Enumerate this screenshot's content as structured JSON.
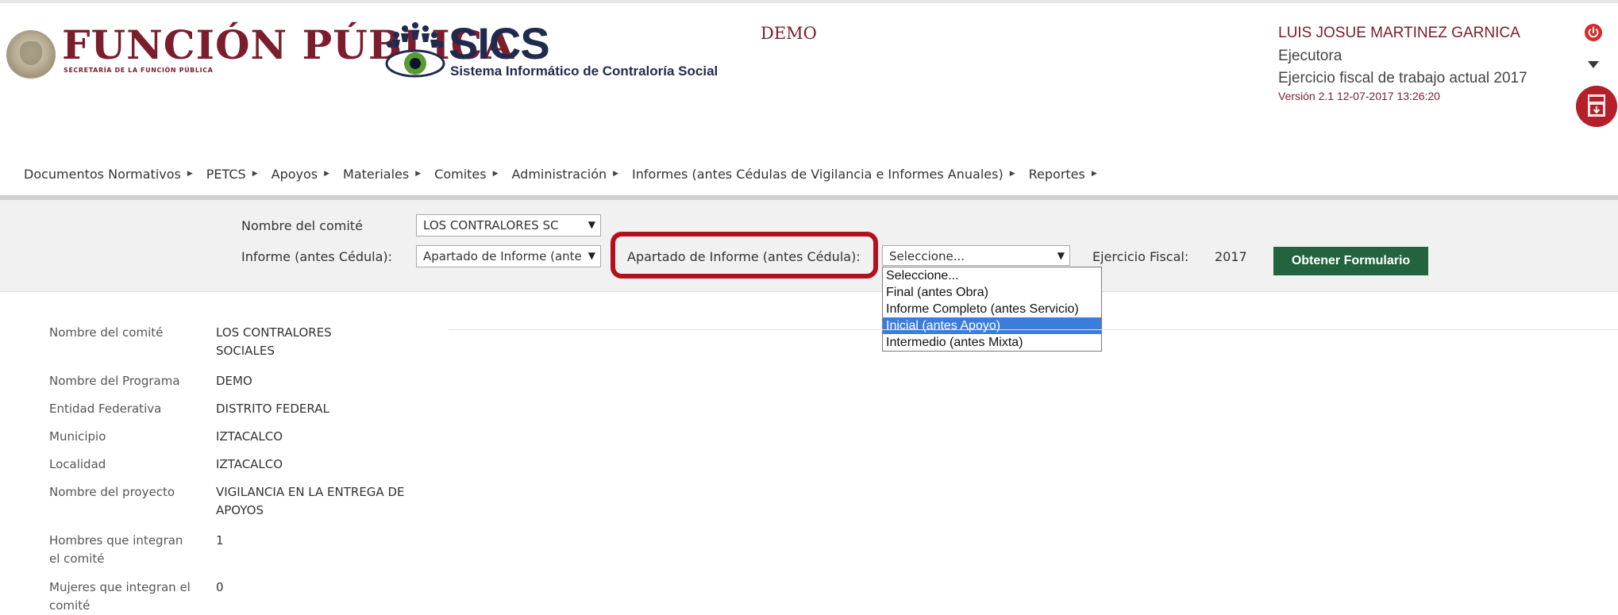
{
  "header": {
    "brand": "FUNCIÓN PÚBLICA",
    "brand_sub": "SECRETARÍA DE LA FUNCIÓN PÚBLICA",
    "app_name": "SICS",
    "app_sub": "Sistema Informático de Contraloría Social",
    "program": "DEMO",
    "user_name": "LUIS JOSUE MARTINEZ GARNICA",
    "role": "Ejecutora",
    "fiscal_year": "Ejercicio fiscal de trabajo actual 2017",
    "version": "Versión 2.1   12-07-2017 13:26:20",
    "accent_color": "#7b1d2c",
    "icons": [
      "power-icon",
      "caret-down-icon",
      "manual-download-icon"
    ]
  },
  "menu": {
    "items": [
      "Documentos Normativos",
      "PETCS",
      "Apoyos",
      "Materiales",
      "Comites",
      "Administración",
      "Informes (antes Cédulas de Vigilancia e Informes Anuales)",
      "Reportes"
    ]
  },
  "filters": {
    "committee_label": "Nombre del comité",
    "committee_value": "LOS CONTRALORES SC",
    "report_label": "Informe (antes Cédula):",
    "report_value": "Apartado de Informe (ante",
    "section_label": "Apartado de Informe (antes Cédula):",
    "section_value": "Seleccione...",
    "fiscal_label": "Ejercicio Fiscal:",
    "fiscal_value": "2017",
    "submit_label": "Obtener Formulario",
    "submit_color": "#23643e"
  },
  "dropdown": {
    "options": [
      "Seleccione...",
      "Final (antes Obra)",
      "Informe Completo (antes Servicio)",
      "Inicial (antes Apoyo)",
      "Intermedio (antes Mixta)"
    ],
    "highlighted": "Inicial (antes Apoyo)",
    "highlight_color": "#3b7dd8"
  },
  "details": [
    {
      "label": "Nombre del comité",
      "value": "LOS CONTRALORES SOCIALES"
    },
    {
      "label": "Nombre del Programa",
      "value": "DEMO"
    },
    {
      "label": "Entidad Federativa",
      "value": "DISTRITO FEDERAL"
    },
    {
      "label": "Municipio",
      "value": "IZTACALCO"
    },
    {
      "label": "Localidad",
      "value": "IZTACALCO"
    },
    {
      "label": "Nombre del proyecto",
      "value": "VIGILANCIA EN LA ENTREGA DE APOYOS"
    },
    {
      "label": "Hombres que integran el comité",
      "value": "1"
    },
    {
      "label": "Mujeres que integran el comité",
      "value": "0"
    }
  ]
}
